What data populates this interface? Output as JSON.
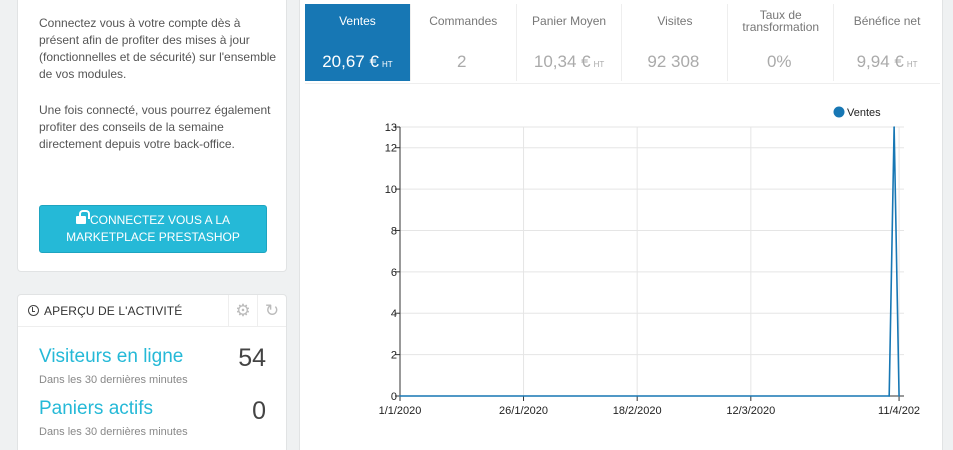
{
  "connect": {
    "paragraph1": "Connectez vous à votre compte dès à présent afin de profiter des mises à jour (fonctionnelles et de sécurité) sur l'ensemble de vos modules.",
    "paragraph2": "Une fois connecté, vous pourrez également profiter des conseils de la semaine directement depuis votre back-office.",
    "button_label": "CONNECTEZ VOUS A LA MARKETPLACE PRESTASHOP"
  },
  "activity": {
    "title": "APERÇU DE L'ACTIVITÉ",
    "visitors_label": "Visiteurs en ligne",
    "visitors_sub": "Dans les 30 dernières minutes",
    "visitors_value": "54",
    "carts_label": "Paniers actifs",
    "carts_sub": "Dans les 30 dernières minutes",
    "carts_value": "0"
  },
  "kpis": [
    {
      "title": "Ventes",
      "value": "20,67 €",
      "suffix": "HT",
      "active": true
    },
    {
      "title": "Commandes",
      "value": "2",
      "suffix": "",
      "active": false
    },
    {
      "title": "Panier Moyen",
      "value": "10,34 €",
      "suffix": "HT",
      "active": false
    },
    {
      "title": "Visites",
      "value": "92 308",
      "suffix": "",
      "active": false
    },
    {
      "title": "Taux de transformation",
      "value": "0%",
      "suffix": "",
      "active": false
    },
    {
      "title": "Bénéfice net",
      "value": "9,94 €",
      "suffix": "HT",
      "active": false
    }
  ],
  "chart_data": {
    "type": "line",
    "title": "",
    "xlabel": "",
    "ylabel": "",
    "x_ticks": [
      "1/1/2020",
      "26/1/2020",
      "18/2/2020",
      "12/3/2020",
      "11/4/202"
    ],
    "y_ticks": [
      0,
      2,
      4,
      6,
      8,
      10,
      12,
      13
    ],
    "ylim": [
      0,
      13
    ],
    "xlim": [
      "2020-01-01",
      "2020-04-12"
    ],
    "grid": true,
    "legend_position": "top-right",
    "series": [
      {
        "name": "Ventes",
        "color": "#1777b4",
        "x": [
          "2020-01-01",
          "2020-04-09",
          "2020-04-10",
          "2020-04-11"
        ],
        "y": [
          0,
          0,
          13,
          0
        ]
      }
    ]
  }
}
